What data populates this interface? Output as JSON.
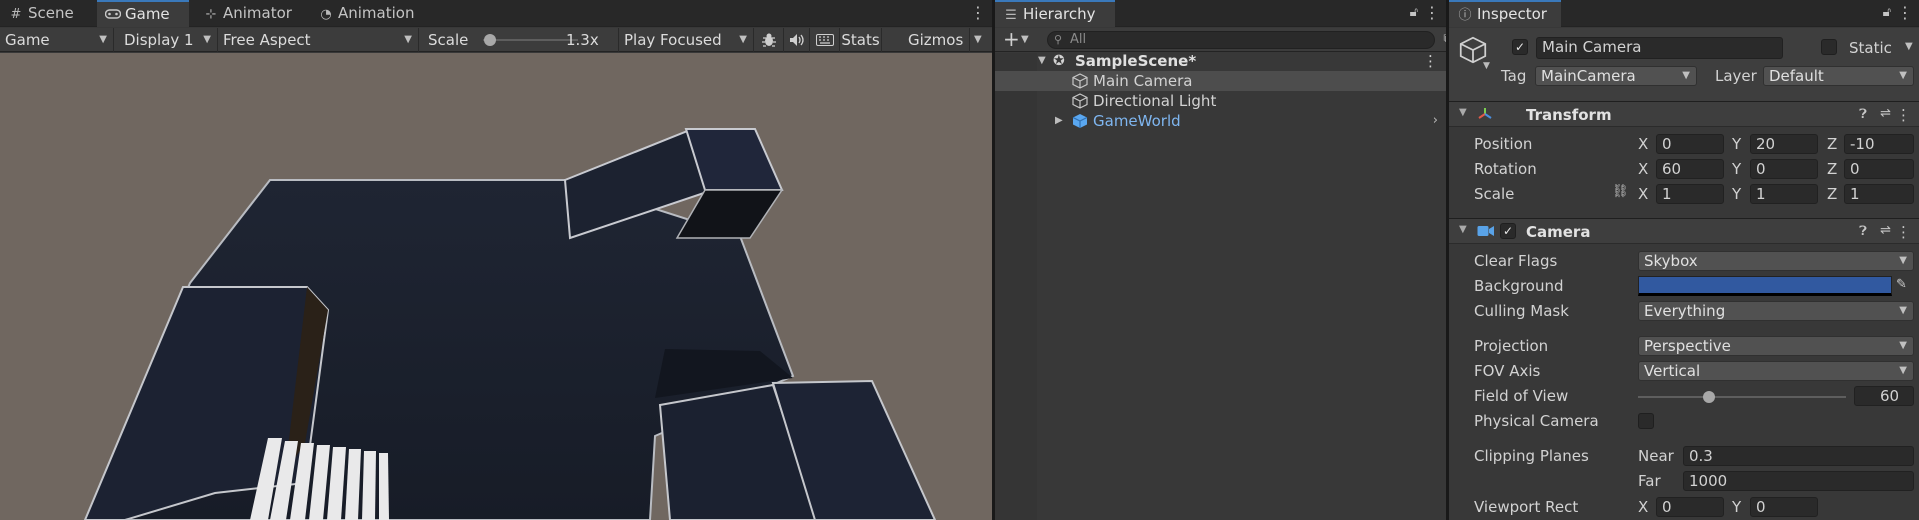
{
  "game": {
    "tabs": [
      {
        "label": "Scene",
        "icon": "grid-icon"
      },
      {
        "label": "Game",
        "icon": "gamepad-icon"
      },
      {
        "label": "Animator",
        "icon": "animator-icon"
      },
      {
        "label": "Animation",
        "icon": "clock-icon"
      }
    ],
    "toolbar": {
      "mode": "Game",
      "display": "Display 1",
      "aspect": "Free Aspect",
      "scale_label": "Scale",
      "scale_value": "1.3x",
      "scale_fraction": 0.03,
      "play_mode": "Play Focused",
      "stats": "Stats",
      "gizmos": "Gizmos"
    },
    "viewport_bg": "#706760",
    "geometry_color": "#1b2230"
  },
  "hierarchy": {
    "tab_label": "Hierarchy",
    "search_placeholder": "All",
    "scene_name": "SampleScene*",
    "items": [
      {
        "label": "Main Camera",
        "selected": true
      },
      {
        "label": "Directional Light",
        "selected": false
      },
      {
        "label": "GameWorld",
        "selected": false,
        "prefab": true
      }
    ]
  },
  "inspector": {
    "tab_label": "Inspector",
    "object_name": "Main Camera",
    "active": true,
    "static_label": "Static",
    "tag_label": "Tag",
    "tag_value": "MainCamera",
    "layer_label": "Layer",
    "layer_value": "Default",
    "transform": {
      "title": "Transform",
      "position": {
        "label": "Position",
        "x": "0",
        "y": "20",
        "z": "-10"
      },
      "rotation": {
        "label": "Rotation",
        "x": "60",
        "y": "0",
        "z": "0"
      },
      "scale": {
        "label": "Scale",
        "x": "1",
        "y": "1",
        "z": "1"
      }
    },
    "camera": {
      "title": "Camera",
      "enabled": true,
      "clear_flags": {
        "label": "Clear Flags",
        "value": "Skybox"
      },
      "background": {
        "label": "Background",
        "color": "#3159a0"
      },
      "culling_mask": {
        "label": "Culling Mask",
        "value": "Everything"
      },
      "projection": {
        "label": "Projection",
        "value": "Perspective"
      },
      "fov_axis": {
        "label": "FOV Axis",
        "value": "Vertical"
      },
      "field_of_view": {
        "label": "Field of View",
        "value": "60",
        "fraction": 0.34
      },
      "physical_camera": {
        "label": "Physical Camera",
        "checked": false
      },
      "clipping_planes": {
        "label": "Clipping Planes",
        "near_label": "Near",
        "near": "0.3",
        "far_label": "Far",
        "far": "1000"
      },
      "viewport_rect": {
        "label": "Viewport Rect",
        "x": "0",
        "y": "0"
      }
    },
    "axis_labels": {
      "x": "X",
      "y": "Y",
      "z": "Z"
    }
  },
  "colors": {
    "accent": "#3a79bb",
    "panel": "#383838",
    "selected_row": "#4d4d4d",
    "prefab_text": "#7fb6f0"
  }
}
